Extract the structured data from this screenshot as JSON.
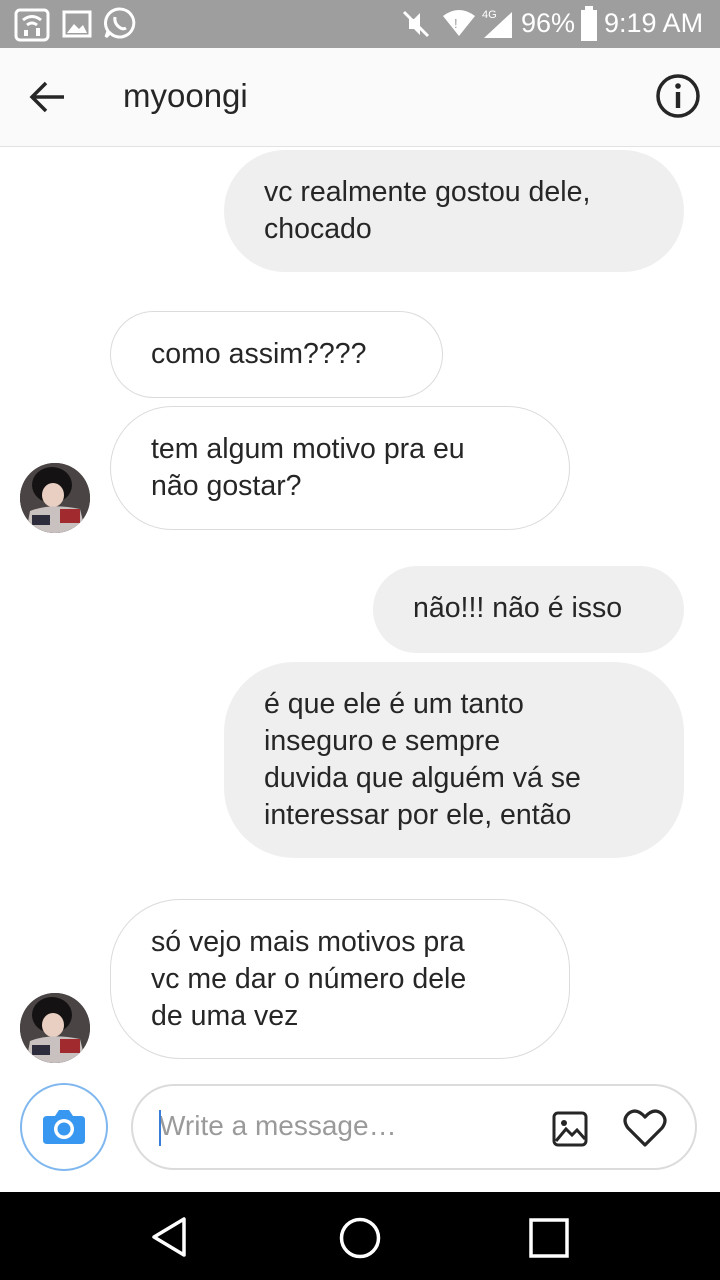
{
  "status_bar": {
    "battery": "96%",
    "time": "9:19 AM",
    "network": "4G",
    "icons": [
      "wifi-calling-icon",
      "image-icon",
      "whatsapp-icon",
      "mute-icon",
      "wifi-icon",
      "signal-icon",
      "battery-icon"
    ]
  },
  "header": {
    "title": "myoongi",
    "back_icon": "arrow-left-icon",
    "info_icon": "info-icon"
  },
  "messages": [
    {
      "direction": "sent",
      "lines": [
        "vc realmente gostou dele,",
        "chocado"
      ]
    },
    {
      "direction": "received",
      "lines": [
        "como assim????"
      ]
    },
    {
      "direction": "received",
      "lines": [
        "tem algum motivo pra eu",
        "não gostar?"
      ]
    },
    {
      "direction": "sent",
      "lines": [
        "não!!! não é isso"
      ]
    },
    {
      "direction": "sent",
      "lines": [
        "é que ele é um tanto",
        "inseguro e sempre",
        "duvida que alguém vá se",
        "interessar por ele, então"
      ]
    },
    {
      "direction": "received",
      "lines": [
        "só vejo mais motivos pra",
        "vc me dar o número dele",
        "de uma vez"
      ]
    }
  ],
  "composer": {
    "placeholder": "Write a message…",
    "value": "",
    "camera_icon": "camera-icon",
    "gallery_icon": "gallery-icon",
    "like_icon": "heart-icon"
  },
  "nav_bar": {
    "icons": [
      "back-triangle-icon",
      "home-circle-icon",
      "recents-square-icon"
    ]
  },
  "colors": {
    "status_bar": "#9e9e9e",
    "sent_bubble": "#efefef",
    "received_border": "#dbdbdb",
    "text": "#262626",
    "accent": "#3897f0"
  }
}
